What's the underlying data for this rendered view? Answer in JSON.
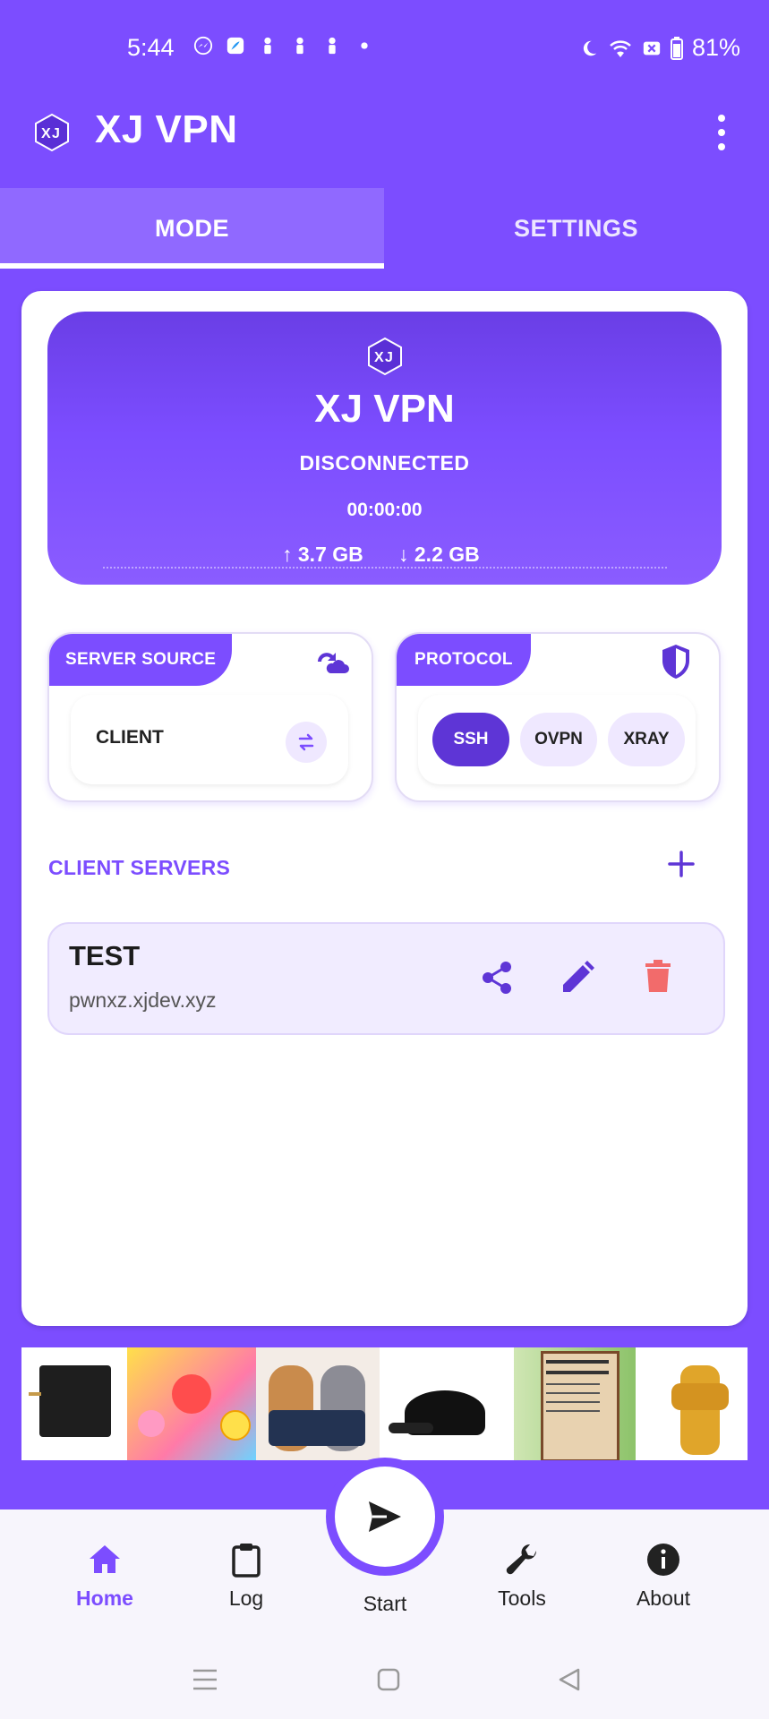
{
  "status_bar": {
    "time": "5:44",
    "battery": "81%",
    "left_icons": [
      "messenger-icon",
      "app-icon",
      "person-icon",
      "person-icon",
      "person-icon",
      "dot-icon"
    ],
    "right_icons": [
      "moon-icon",
      "wifi-icon",
      "sim-off-icon",
      "battery-icon"
    ]
  },
  "app_bar": {
    "title": "XJ VPN",
    "logo_icon": "xj-logo-icon",
    "menu_icon": "more-vert-icon"
  },
  "tabs": [
    {
      "label": "MODE",
      "active": true
    },
    {
      "label": "SETTINGS",
      "active": false
    }
  ],
  "connection": {
    "title": "XJ VPN",
    "status": "DISCONNECTED",
    "timer": "00:00:00",
    "upload": "3.7 GB",
    "download": "2.2 GB"
  },
  "server_source": {
    "tag": "SERVER SOURCE",
    "value": "CLIENT",
    "icon": "cloud-sync-icon",
    "swap_icon": "swap-icon"
  },
  "protocol": {
    "tag": "PROTOCOL",
    "icon": "shield-icon",
    "options": [
      "SSH",
      "OVPN",
      "XRAY"
    ],
    "selected": "SSH"
  },
  "client_servers": {
    "title": "CLIENT SERVERS",
    "add_icon": "plus-icon",
    "items": [
      {
        "name": "TEST",
        "host": "pwnxz.xjdev.xyz"
      }
    ]
  },
  "bottom_nav": {
    "items": [
      {
        "label": "Home",
        "icon": "home-icon",
        "active": true
      },
      {
        "label": "Log",
        "icon": "clipboard-icon"
      },
      {
        "label": "Start",
        "icon": "send-icon"
      },
      {
        "label": "Tools",
        "icon": "wrench-icon"
      },
      {
        "label": "About",
        "icon": "info-icon"
      }
    ]
  },
  "colors": {
    "primary": "#7c4dff",
    "primary_dark": "#5e35d6",
    "delete": "#f26b6b",
    "surface": "#ffffff"
  }
}
